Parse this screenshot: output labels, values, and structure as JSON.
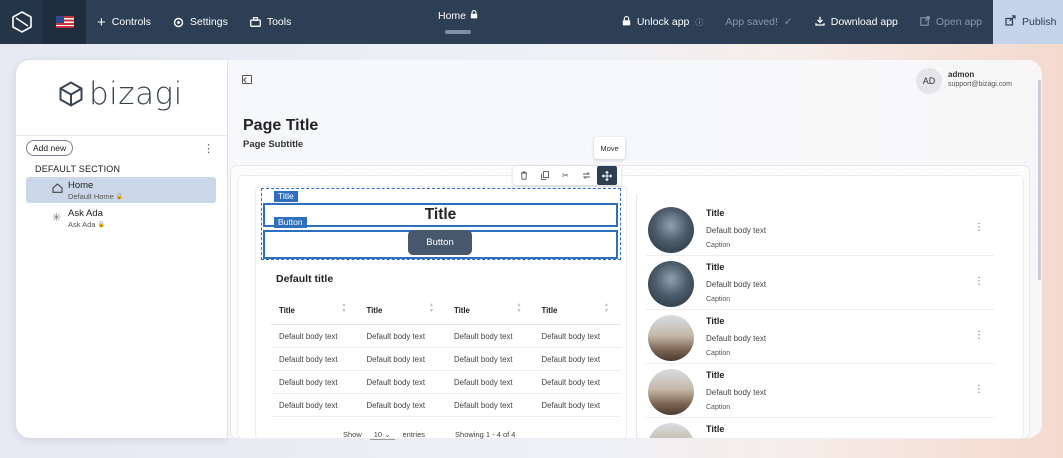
{
  "topbar": {
    "controls": "Controls",
    "settings": "Settings",
    "tools": "Tools",
    "page_name": "Home",
    "unlock": "Unlock app",
    "saved": "App saved!",
    "download": "Download app",
    "open": "Open app",
    "publish": "Publish"
  },
  "sidebar": {
    "brand": "bizagi",
    "add_new": "Add new",
    "section_title": "DEFAULT SECTION",
    "items": [
      {
        "title": "Home",
        "subtitle": "Default Home",
        "icon": "home-icon"
      },
      {
        "title": "Ask Ada",
        "subtitle": "Ask Ada",
        "icon": "sparkle-icon"
      }
    ]
  },
  "user": {
    "initials": "AD",
    "name": "admon",
    "email": "support@bizagi.com"
  },
  "page": {
    "title": "Page Title",
    "subtitle": "Page Subtitle"
  },
  "tooltip": "Move",
  "selection": {
    "title_tag": "Title",
    "title_text": "Title",
    "button_tag": "Button",
    "button_label": "Button"
  },
  "table": {
    "title": "Default title",
    "headers": [
      "Title",
      "Title",
      "Title",
      "Title"
    ],
    "rows": [
      [
        "Default body text",
        "Default body text",
        "Default body text",
        "Default body text"
      ],
      [
        "Default body text",
        "Default body text",
        "Default body text",
        "Default body text"
      ],
      [
        "Default body text",
        "Default body text",
        "Default body text",
        "Default body text"
      ],
      [
        "Default body text",
        "Default body text",
        "Default body text",
        "Default body text"
      ]
    ],
    "show_label": "Show",
    "page_size": "10",
    "entries_label": "entries",
    "showing": "Showing 1 - 4 of 4"
  },
  "list": {
    "items": [
      {
        "title": "Title",
        "body": "Default body text",
        "caption": "Caption",
        "image": "city"
      },
      {
        "title": "Title",
        "body": "Default body text",
        "caption": "Caption",
        "image": "city"
      },
      {
        "title": "Title",
        "body": "Default body text",
        "caption": "Caption",
        "image": "church"
      },
      {
        "title": "Title",
        "body": "Default body text",
        "caption": "Caption",
        "image": "church"
      },
      {
        "title": "Title",
        "body": "",
        "caption": "",
        "image": "church"
      }
    ]
  },
  "colors": {
    "topbar": "#2d3f55",
    "accent": "#2f6fc0",
    "publish_bg": "#c5d4ea"
  }
}
